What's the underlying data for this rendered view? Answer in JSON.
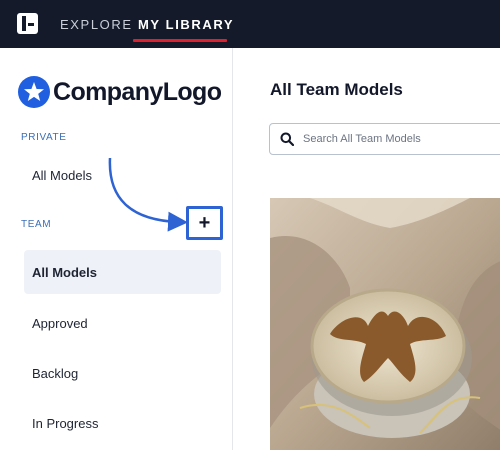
{
  "nav": {
    "tabs": [
      {
        "label": "EXPLORE",
        "active": false
      },
      {
        "label": "MY LIBRARY",
        "active": true
      }
    ],
    "accent_color": "#e0202c",
    "background": "#141a2a"
  },
  "brand": {
    "logo_icon": "star-circle-icon",
    "name": "CompanyLogo",
    "color": "#1f5fe0"
  },
  "sidebar": {
    "private": {
      "label": "PRIVATE",
      "items": [
        {
          "label": "All Models"
        }
      ]
    },
    "team": {
      "label": "TEAM",
      "add_label": "+",
      "items": [
        {
          "label": "All Models",
          "active": true
        },
        {
          "label": "Approved"
        },
        {
          "label": "Backlog"
        },
        {
          "label": "In Progress"
        }
      ]
    }
  },
  "main": {
    "title": "All Team Models",
    "search": {
      "placeholder": "Search All Team Models",
      "value": ""
    },
    "models": [
      {
        "thumbnail": "spinal-cord-cross-section"
      }
    ]
  }
}
